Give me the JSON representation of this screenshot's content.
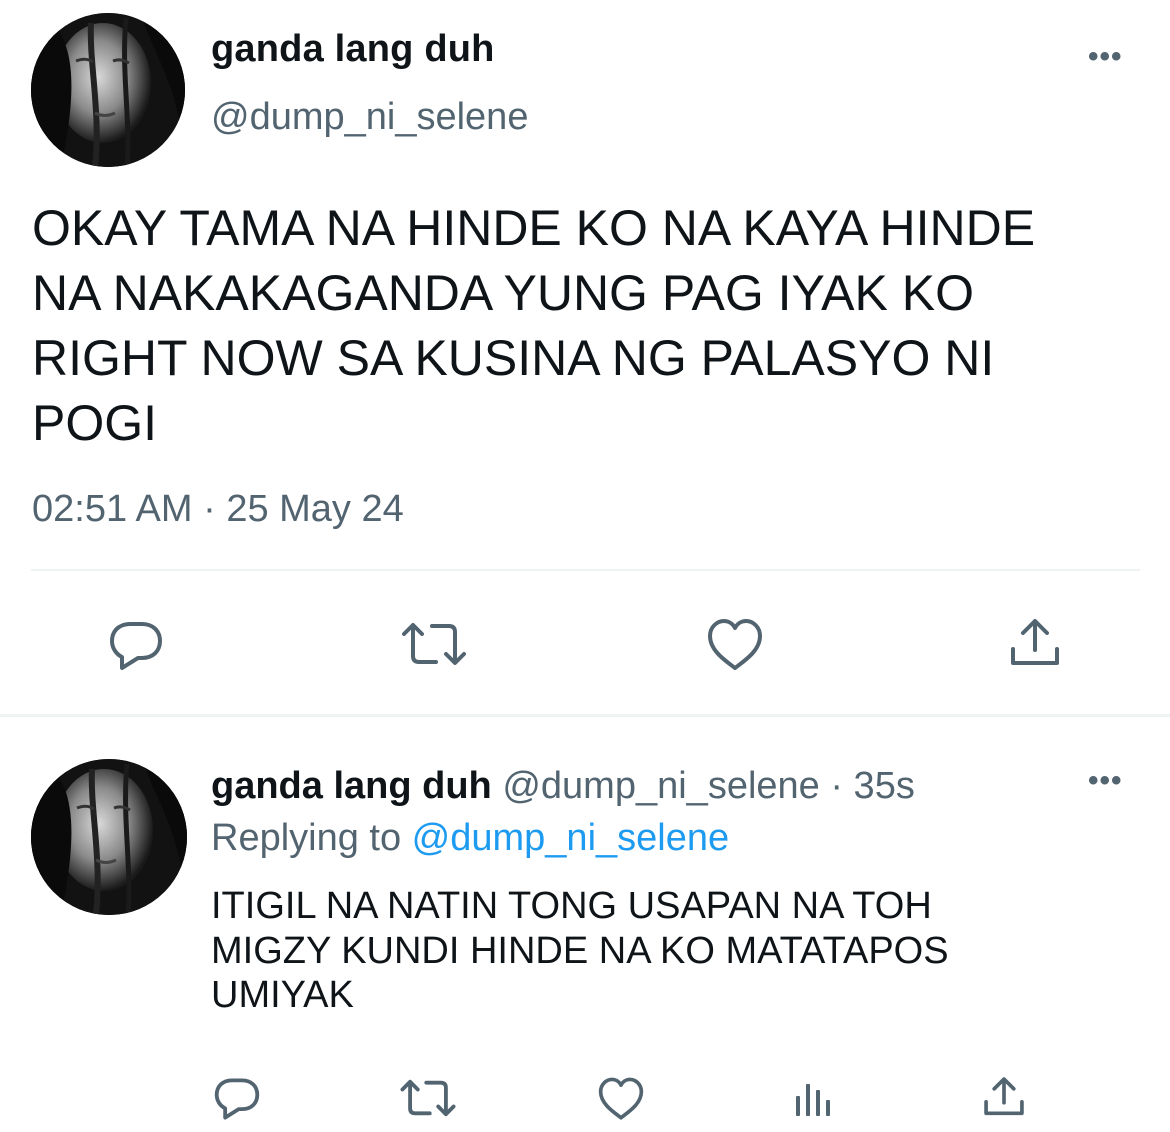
{
  "main_tweet": {
    "display_name": "ganda lang duh",
    "handle": "@dump_ni_selene",
    "more_label": "•••",
    "text": "OKAY TAMA NA HINDE KO NA KAYA HINDE\nNA NAKAKAGANDA YUNG PAG IYAK KO\nRIGHT NOW SA KUSINA NG PALASYO NI\nPOGI",
    "timestamp": "02:51 AM · 25 May 24",
    "actions": {
      "reply_icon": "reply-bubble-icon",
      "retweet_icon": "retweet-icon",
      "like_icon": "heart-icon",
      "share_icon": "share-icon"
    }
  },
  "reply_tweet": {
    "display_name": "ganda lang duh",
    "meta": " @dump_ni_selene · 35s",
    "replying_prefix": "Replying to ",
    "replying_handle": "@dump_ni_selene",
    "more_label": "•••",
    "text": "ITIGIL NA NATIN TONG USAPAN NA TOH\nMIGZY KUNDI HINDE NA KO MATATAPOS\nUMIYAK",
    "actions": {
      "reply_icon": "reply-bubble-icon",
      "retweet_icon": "retweet-icon",
      "like_icon": "heart-icon",
      "analytics_icon": "analytics-icon",
      "share_icon": "share-icon"
    }
  },
  "colors": {
    "text_primary": "#0f1419",
    "text_secondary": "#536471",
    "link": "#1d9bf0",
    "divider": "#eff3f4"
  }
}
